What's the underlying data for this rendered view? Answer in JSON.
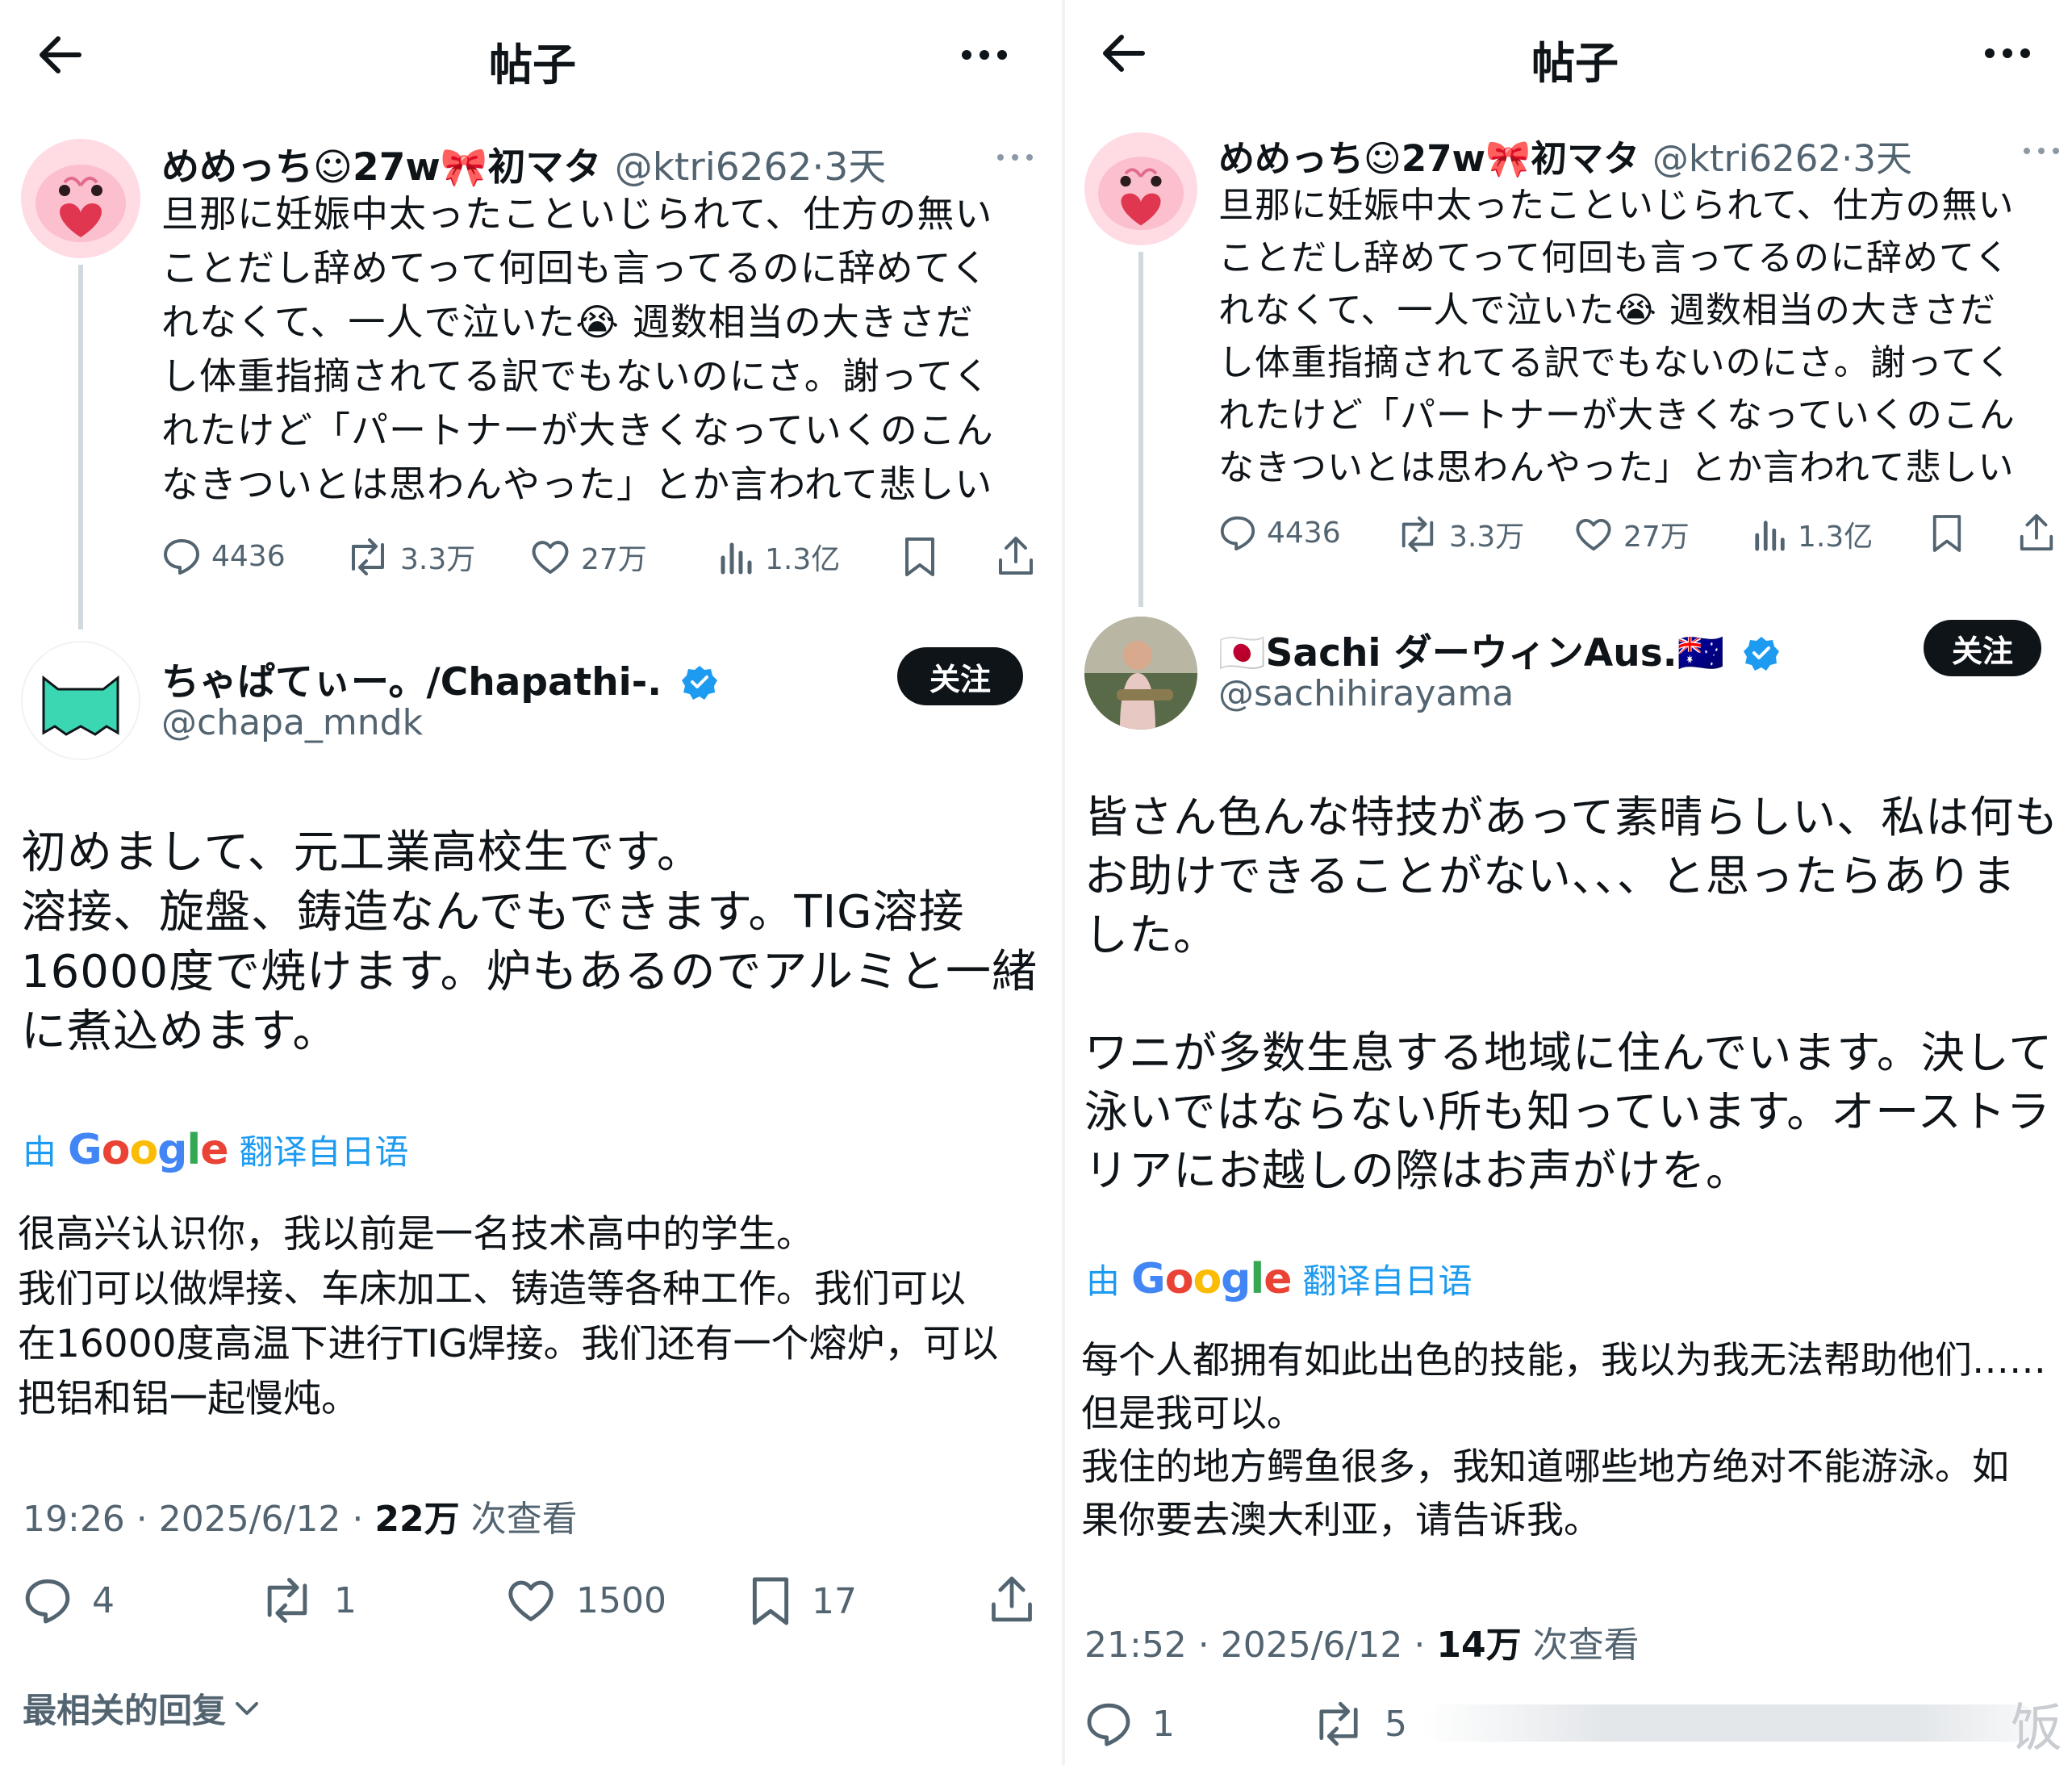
{
  "left": {
    "topbar": {
      "title": "帖子"
    },
    "quoted": {
      "name": "めめっち☺27w🎀初マタ",
      "handle": "@ktri6262",
      "dot": "·",
      "time": "3天",
      "lines": [
        "旦那に妊娠中太ったこといじられて、仕方の無い",
        "ことだし辞めてって何回も言ってるのに辞めてく",
        "れなくて、一人で泣いた😭 週数相当の大きさだ",
        "し体重指摘されてる訳でもないのにさ。謝ってく",
        "れたけど「パートナーが大きくなっていくのこん",
        "なきついとは思わんやった」とか言われて悲しい"
      ],
      "stats": {
        "replies": "4436",
        "reposts": "3.3万",
        "likes": "27万",
        "views": "1.3亿"
      }
    },
    "reply": {
      "name": "ちゃぱてぃー。/Chapathi-.",
      "handle": "@chapa_mndk",
      "follow_label": "关注",
      "text": "初めまして、元工業高校生です。\n溶接、旋盤、鋳造なんでもできます。TIG溶接\n16000度で焼けます。炉もあるのでアルミと一緒\nに煮込めます。",
      "translation_prefix": "由",
      "translation_brand": "Google",
      "translation_suffix": "翻译自日语",
      "translation_text": "很高兴认识你，我以前是一名技术高中的学生。\n我们可以做焊接、车床加工、铸造等各种工作。我们可以\n在16000度高温下进行TIG焊接。我们还有一个熔炉，可以\n把铝和铝一起慢炖。",
      "meta_time": "19:26 · 2025/6/12 ·",
      "meta_views": "22万",
      "meta_views_label": "次查看",
      "stats": {
        "replies": "4",
        "reposts": "1",
        "likes": "1500",
        "bookmarks": "17"
      },
      "relevant_label": "最相关的回复"
    }
  },
  "right": {
    "topbar": {
      "title": "帖子"
    },
    "quoted": {
      "name": "めめっち☺27w🎀初マタ",
      "handle": "@ktri6262",
      "dot": "·",
      "time": "3天",
      "lines": [
        "旦那に妊娠中太ったこといじられて、仕方の無い",
        "ことだし辞めてって何回も言ってるのに辞めてく",
        "れなくて、一人で泣いた😭 週数相当の大きさだ",
        "し体重指摘されてる訳でもないのにさ。謝ってく",
        "れたけど「パートナーが大きくなっていくのこん",
        "なきついとは思わんやった」とか言われて悲しい"
      ],
      "stats": {
        "replies": "4436",
        "reposts": "3.3万",
        "likes": "27万",
        "views": "1.3亿"
      }
    },
    "reply": {
      "name": "🇯🇵Sachi ダーウィンAus.🇦🇺",
      "handle": "@sachihirayama",
      "follow_label": "关注",
      "text": "皆さん色んな特技があって素晴らしい、私は何も\nお助けできることがない、、、と思ったらありま\nした。\n\nワニが多数生息する地域に住んでいます。決して\n泳いではならない所も知っています。オーストラ\nリアにお越しの際はお声がけを。",
      "translation_prefix": "由",
      "translation_brand": "Google",
      "translation_suffix": "翻译自日语",
      "translation_text": "每个人都拥有如此出色的技能，我以为我无法帮助他们……\n但是我可以。\n我住的地方鳄鱼很多，我知道哪些地方绝对不能游泳。如\n果你要去澳大利亚，请告诉我。",
      "meta_time": "21:52 · 2025/6/12 ·",
      "meta_views": "14万",
      "meta_views_label": "次查看",
      "stats": {
        "replies": "1",
        "reposts": "5"
      }
    },
    "watermark": "饭"
  },
  "colors": {
    "text_primary": "#0f1419",
    "text_secondary": "#536471",
    "link_blue": "#1d9bf0",
    "verified_blue": "#1d9bf0",
    "thread_line": "#cfd9de"
  }
}
